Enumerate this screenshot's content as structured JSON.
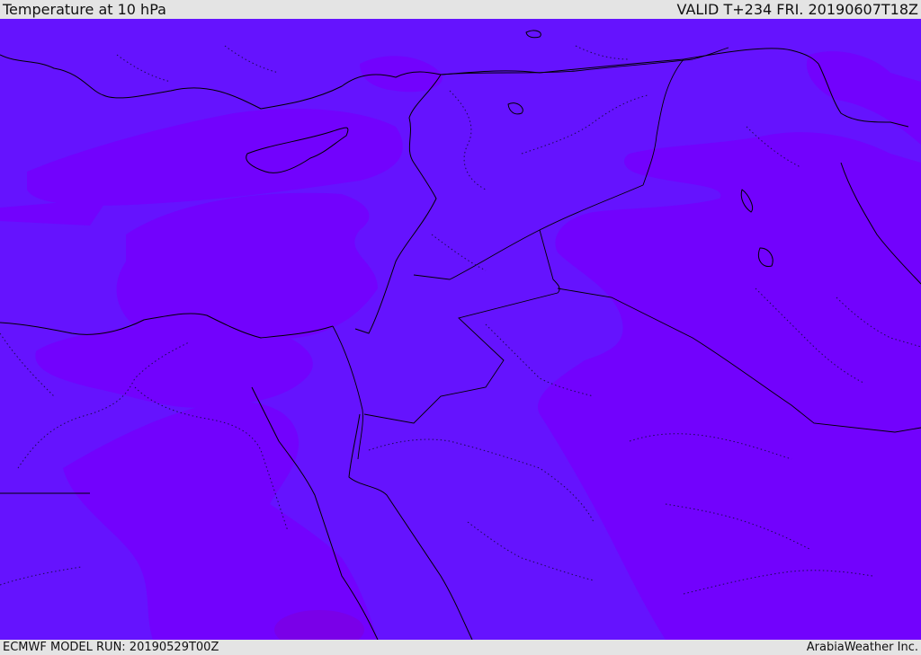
{
  "header": {
    "title": "Temperature at 10 hPa",
    "valid": "VALID T+234 FRI. 20190607T18Z"
  },
  "footer": {
    "model_run": "ECMWF MODEL RUN: 20190529T00Z",
    "credit": "ArabiaWeather Inc."
  },
  "map": {
    "field_colors": {
      "base": "#6513fe",
      "warm": "#7202fd",
      "warmest": "#7a00e8"
    },
    "coastline_color": "#000000"
  }
}
